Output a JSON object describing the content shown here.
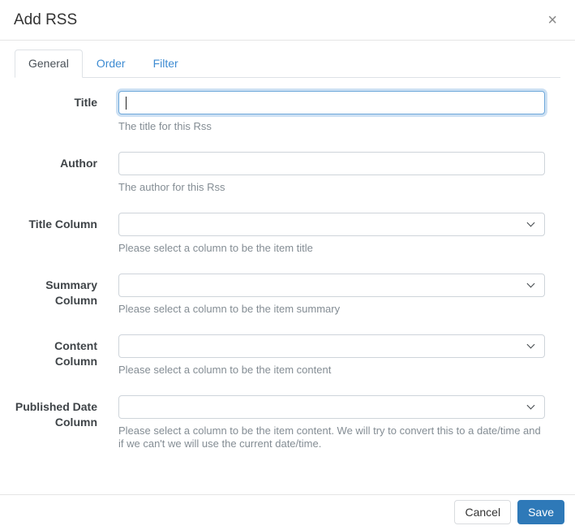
{
  "modal": {
    "title": "Add RSS",
    "close_icon": "×"
  },
  "tabs": [
    {
      "label": "General",
      "active": true
    },
    {
      "label": "Order",
      "active": false
    },
    {
      "label": "Filter",
      "active": false
    }
  ],
  "form": {
    "fields": [
      {
        "label": "Title",
        "type": "text",
        "value": "",
        "help": "The title for this Rss",
        "focused": true
      },
      {
        "label": "Author",
        "type": "text",
        "value": "",
        "help": "The author for this Rss",
        "focused": false
      },
      {
        "label": "Title Column",
        "type": "select",
        "value": "",
        "help": "Please select a column to be the item title"
      },
      {
        "label": "Summary Column",
        "type": "select",
        "value": "",
        "help": "Please select a column to be the item summary"
      },
      {
        "label": "Content Column",
        "type": "select",
        "value": "",
        "help": "Please select a column to be the item content"
      },
      {
        "label": "Published Date Column",
        "type": "select",
        "value": "",
        "help": "Please select a column to be the item content. We will try to convert this to a date/time and if we can't we will use the current date/time."
      }
    ]
  },
  "footer": {
    "cancel_label": "Cancel",
    "save_label": "Save"
  },
  "icons": {
    "close": "close-icon",
    "select_arrow": "chevron-down-icon"
  },
  "colors": {
    "accent": "#2e79b8",
    "link": "#3d8bd2",
    "focus_border": "#6ea8da",
    "input_border": "#ced4da",
    "divider": "#e5e5e5",
    "help_text": "#848d94",
    "label_text": "#3f4448"
  }
}
